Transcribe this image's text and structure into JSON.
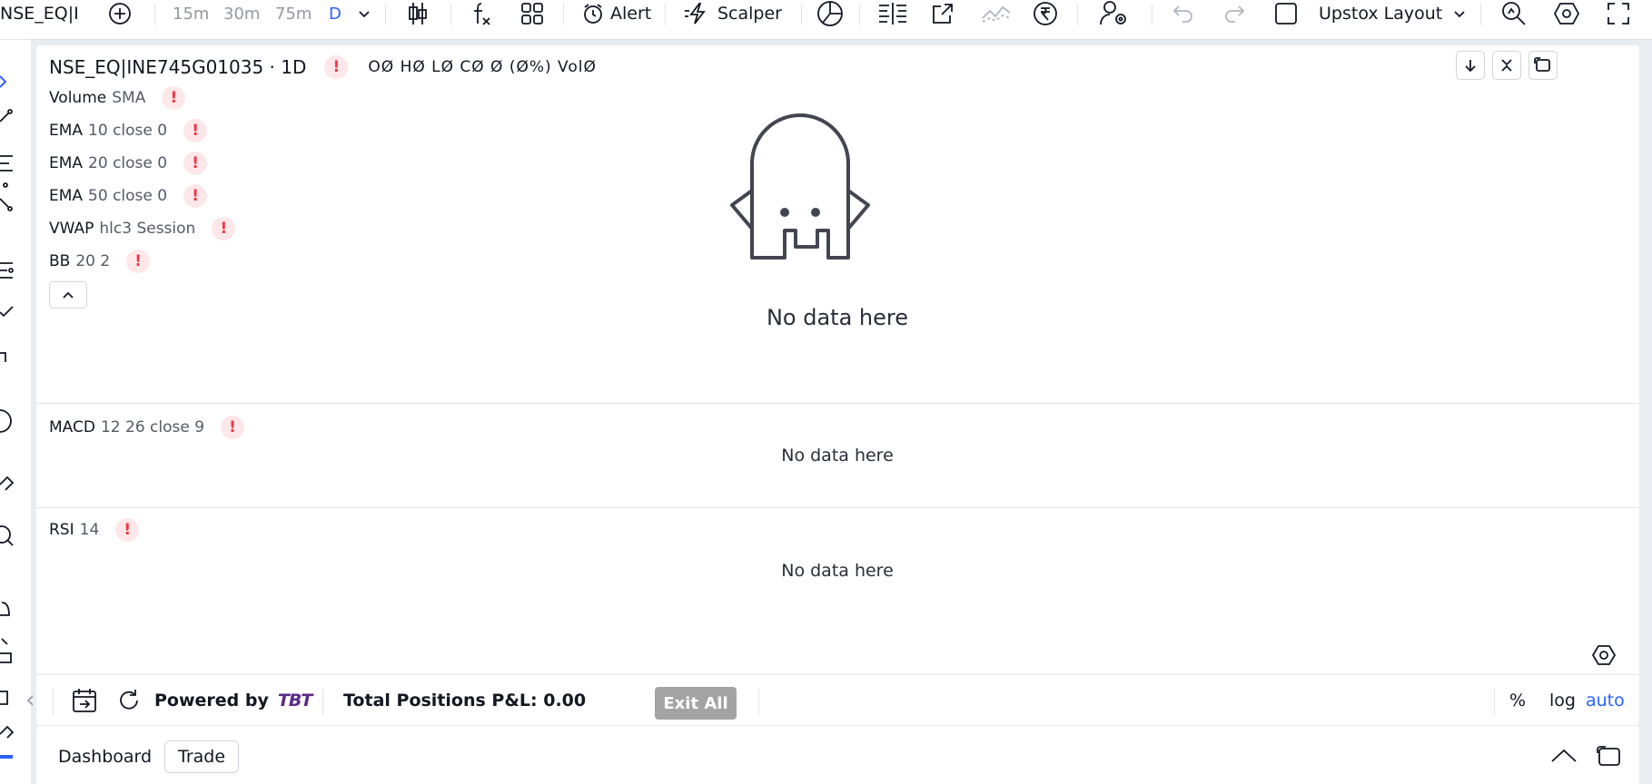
{
  "toolbar": {
    "symbol": "NSE_EQ|I",
    "intervals": [
      "15m",
      "30m",
      "75m",
      "D"
    ],
    "active_interval": "D",
    "alert_label": "Alert",
    "scalper_label": "Scalper",
    "layout_label": "Upstox Layout"
  },
  "chart": {
    "title": "NSE_EQ|INE745G01035 · 1D",
    "ohlc": "OØ HØ LØ CØ Ø (Ø%) VolØ",
    "main_indicators": [
      {
        "name": "Volume",
        "params": "SMA"
      },
      {
        "name": "EMA",
        "params": "10 close 0"
      },
      {
        "name": "EMA",
        "params": "20 close 0"
      },
      {
        "name": "EMA",
        "params": "50 close 0"
      },
      {
        "name": "VWAP",
        "params": "hlc3 Session"
      },
      {
        "name": "BB",
        "params": "20 2"
      }
    ],
    "no_data_text": "No data here",
    "warn_mark": "!",
    "panes": [
      {
        "name": "MACD",
        "params": "12 26 close 9",
        "no_data_text": "No data here"
      },
      {
        "name": "RSI",
        "params": "14",
        "no_data_text": "No data here"
      }
    ]
  },
  "statusbar": {
    "powered_by": "Powered by",
    "brand": "TBT",
    "pnl_label": "Total Positions P&L: 0.00",
    "exit_all": "Exit All",
    "scale_percent": "%",
    "scale_log": "log",
    "scale_auto": "auto"
  },
  "dashboard": {
    "tabs": [
      "Dashboard",
      "Trade"
    ]
  },
  "colors": {
    "accent": "#2962ff",
    "warning": "#f23645",
    "brand_tbt": "#5b2a86"
  }
}
